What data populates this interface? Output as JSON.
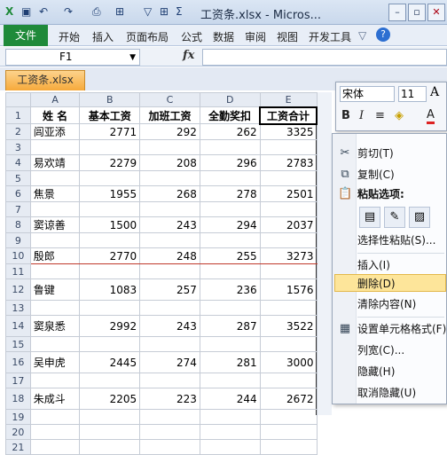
{
  "window": {
    "title": "工资条.xlsx - Micros...",
    "quick_access": [
      "Excel-icon",
      "save-icon",
      "undo-icon",
      "redo-icon"
    ],
    "controls": [
      "minimize",
      "restore",
      "close"
    ]
  },
  "ribbon": {
    "file_tab": "文件",
    "tabs": [
      "开始",
      "插入",
      "页面布局",
      "公式",
      "数据",
      "审阅",
      "视图",
      "开发工具"
    ]
  },
  "formula_bar": {
    "name_box": "F1",
    "fx_label": "fx",
    "value": ""
  },
  "workbook_tab": "工资条.xlsx",
  "sheet": {
    "columns": [
      "A",
      "B",
      "C",
      "D",
      "E"
    ],
    "header": [
      "姓 名",
      "基本工资",
      "加班工资",
      "全勤奖扣",
      "工资合计"
    ],
    "rows": [
      {
        "n": "1",
        "cells": [
          "姓 名",
          "基本工资",
          "加班工资",
          "全勤奖扣",
          "工资合计"
        ]
      },
      {
        "n": "2",
        "cells": [
          "闾亚添",
          "2771",
          "292",
          "262",
          "3325"
        ]
      },
      {
        "n": "3",
        "cells": [
          "",
          "",
          "",
          "",
          ""
        ]
      },
      {
        "n": "4",
        "cells": [
          "易欢靖",
          "2279",
          "208",
          "296",
          "2783"
        ]
      },
      {
        "n": "5",
        "cells": [
          "",
          "",
          "",
          "",
          ""
        ]
      },
      {
        "n": "6",
        "cells": [
          "焦景",
          "1955",
          "268",
          "278",
          "2501"
        ]
      },
      {
        "n": "7",
        "cells": [
          "",
          "",
          "",
          "",
          ""
        ]
      },
      {
        "n": "8",
        "cells": [
          "窦谅善",
          "1500",
          "243",
          "294",
          "2037"
        ]
      },
      {
        "n": "9",
        "cells": [
          "",
          "",
          "",
          "",
          ""
        ]
      },
      {
        "n": "10",
        "cells": [
          "殷郎",
          "2770",
          "248",
          "255",
          "3273"
        ]
      },
      {
        "n": "11",
        "cells": [
          "",
          "",
          "",
          "",
          ""
        ]
      },
      {
        "n": "12",
        "cells": [
          "鲁键",
          "1083",
          "257",
          "236",
          "1576"
        ]
      },
      {
        "n": "13",
        "cells": [
          "",
          "",
          "",
          "",
          ""
        ]
      },
      {
        "n": "14",
        "cells": [
          "窦泉悉",
          "2992",
          "243",
          "287",
          "3522"
        ]
      },
      {
        "n": "15",
        "cells": [
          "",
          "",
          "",
          "",
          ""
        ]
      },
      {
        "n": "16",
        "cells": [
          "吴申虎",
          "2445",
          "274",
          "281",
          "3000"
        ]
      },
      {
        "n": "17",
        "cells": [
          "",
          "",
          "",
          "",
          ""
        ]
      },
      {
        "n": "18",
        "cells": [
          "朱成斗",
          "2205",
          "223",
          "244",
          "2672"
        ]
      },
      {
        "n": "19",
        "cells": [
          "",
          "",
          "",
          "",
          ""
        ]
      },
      {
        "n": "20",
        "cells": [
          "",
          "",
          "",
          "",
          ""
        ]
      },
      {
        "n": "21",
        "cells": [
          "",
          "",
          "",
          "",
          ""
        ]
      }
    ]
  },
  "mini_toolbar": {
    "font": "宋体",
    "size": "11",
    "buttons": [
      "B",
      "I",
      "≡",
      "A"
    ]
  },
  "context_menu": {
    "cut": "剪切(T)",
    "copy": "复制(C)",
    "paste_options": "粘贴选项:",
    "paste_special": "选择性粘贴(S)...",
    "insert": "插入(I)",
    "delete": "删除(D)",
    "clear": "清除内容(N)",
    "format_cells": "设置单元格格式(F)...",
    "col_width": "列宽(C)...",
    "hide": "隐藏(H)",
    "unhide": "取消隐藏(U)"
  },
  "colors": {
    "file_tab": "#1f8a3a",
    "workbook_tab": "#f6a93b",
    "menu_highlight": "#fde59a",
    "row_divider": "#c0392b"
  }
}
